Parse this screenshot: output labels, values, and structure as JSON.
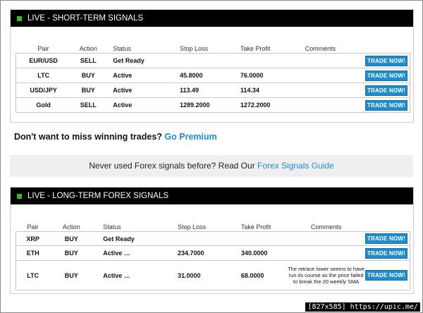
{
  "short_term": {
    "title": "LIVE - SHORT-TERM SIGNALS",
    "columns": [
      "Pair",
      "Action",
      "Status",
      "Stop Loss",
      "Take Profit",
      "Comments"
    ],
    "rows": [
      {
        "pair": "EUR/USD",
        "action": "SELL",
        "status": "Get Ready",
        "stop_loss": "",
        "take_profit": "",
        "comment": "",
        "button": "TRADE NOW!"
      },
      {
        "pair": "LTC",
        "action": "BUY",
        "status": "Active",
        "stop_loss": "45.8000",
        "take_profit": "76.0000",
        "comment": "",
        "button": "TRADE NOW!"
      },
      {
        "pair": "USD/JPY",
        "action": "BUY",
        "status": "Active",
        "stop_loss": "113.49",
        "take_profit": "114.34",
        "comment": "",
        "button": "TRADE NOW!"
      },
      {
        "pair": "Gold",
        "action": "SELL",
        "status": "Active",
        "stop_loss": "1289.2000",
        "take_profit": "1272.2000",
        "comment": "",
        "button": "TRADE NOW!"
      }
    ]
  },
  "premium": {
    "text": "Don't want to miss winning trades?",
    "link": "Go Premium"
  },
  "banner": {
    "text": "Never used Forex signals before? Read Our",
    "link": "Forex Signals Guide"
  },
  "long_term": {
    "title": "LIVE - LONG-TERM FOREX SIGNALS",
    "columns": [
      "Pair",
      "Action",
      "Status",
      "Stop Loss",
      "Take Profit",
      "Comments"
    ],
    "rows": [
      {
        "pair": "XRP",
        "action": "BUY",
        "status": "Get Ready",
        "stop_loss": "",
        "take_profit": "",
        "comment": "",
        "button": "TRADE NOW!"
      },
      {
        "pair": "ETH",
        "action": "BUY",
        "status": "Active …",
        "stop_loss": "234.7000",
        "take_profit": "340.0000",
        "comment": "",
        "button": "TRADE NOW!"
      },
      {
        "pair": "LTC",
        "action": "BUY",
        "status": "Active …",
        "stop_loss": "31.0000",
        "take_profit": "68.0000",
        "comment": "The retrace lower seems to have run its course as the price failed to break the 20 weekly SMA",
        "button": "TRADE NOW!"
      }
    ]
  },
  "watermark": "[827x585] https://upic.me/",
  "colors": {
    "header_bg": "#000000",
    "accent_square": "#3ab72e",
    "sell": "#d9261c",
    "buy": "#44a527",
    "button": "#1f8ccd"
  }
}
